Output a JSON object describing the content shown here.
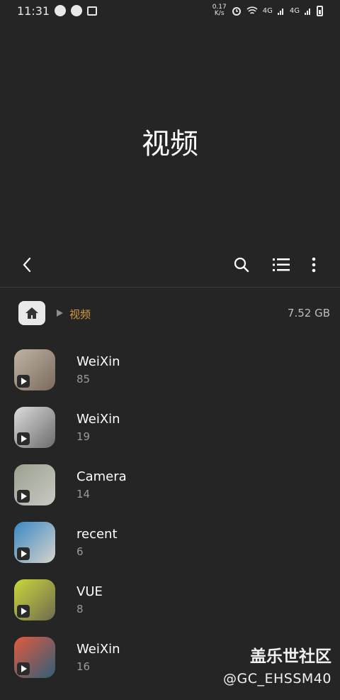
{
  "status_bar": {
    "time": "11:31",
    "net_speed_top": "0.17",
    "net_speed_bottom": "K/s",
    "sim_a": "4G",
    "sim_b": "4G"
  },
  "header": {
    "title": "视频"
  },
  "breadcrumb": {
    "current": "视频",
    "storage": "7.52 GB"
  },
  "folders": [
    {
      "name": "WeiXin",
      "count": "85",
      "thumb_colors": [
        "#bfb4a6",
        "#7a6a5c"
      ]
    },
    {
      "name": "WeiXin",
      "count": "19",
      "thumb_colors": [
        "#dcdcdc",
        "#6b6b6b"
      ]
    },
    {
      "name": "Camera",
      "count": "14",
      "thumb_colors": [
        "#9aa18f",
        "#c9c9c4"
      ]
    },
    {
      "name": "recent",
      "count": "6",
      "thumb_colors": [
        "#3b88c4",
        "#d7d3cc"
      ]
    },
    {
      "name": "VUE",
      "count": "8",
      "thumb_colors": [
        "#c9d83a",
        "#6f6b4f"
      ]
    },
    {
      "name": "WeiXin",
      "count": "16",
      "thumb_colors": [
        "#e25a3e",
        "#2f5f7a"
      ]
    }
  ],
  "watermark": {
    "main": "盖乐世社区",
    "sub": "@GC_EHSSM40"
  }
}
